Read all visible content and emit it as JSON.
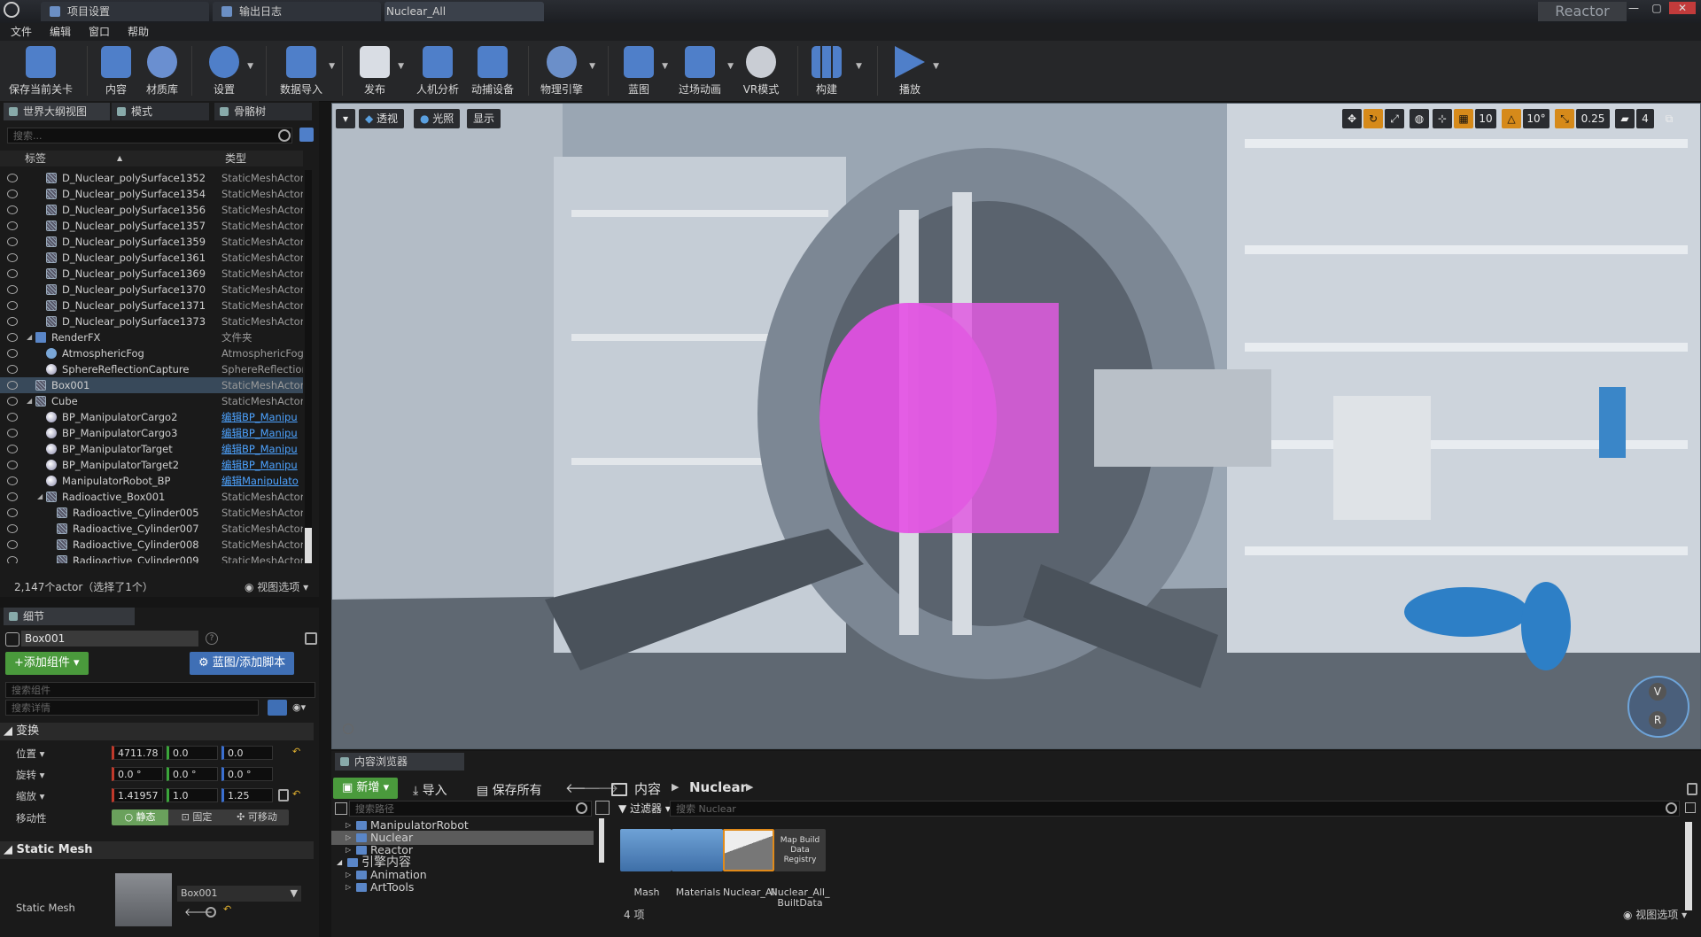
{
  "titlebar": {
    "tabs": [
      {
        "label": "项目设置"
      },
      {
        "label": "输出日志"
      },
      {
        "label": "Nuclear_All"
      }
    ],
    "project_name": "Reactor"
  },
  "menubar": {
    "items": [
      "文件",
      "编辑",
      "窗口",
      "帮助"
    ]
  },
  "toolbar": {
    "buttons": [
      {
        "label": "保存当前关卡",
        "icon": "save-icon"
      },
      {
        "label": "内容",
        "icon": "content-grid-icon"
      },
      {
        "label": "材质库",
        "icon": "material-spheres-icon"
      },
      {
        "label": "设置",
        "icon": "gear-icon"
      },
      {
        "label": "数据导入",
        "icon": "data-import-icon"
      },
      {
        "label": "发布",
        "icon": "publish-icon"
      },
      {
        "label": "人机分析",
        "icon": "ergonomics-icon"
      },
      {
        "label": "动捕设备",
        "icon": "motion-capture-icon"
      },
      {
        "label": "物理引擎",
        "icon": "physics-gear-icon"
      },
      {
        "label": "蓝图",
        "icon": "blueprint-icon"
      },
      {
        "label": "过场动画",
        "icon": "cinematics-icon"
      },
      {
        "label": "VR模式",
        "icon": "vr-headset-icon"
      },
      {
        "label": "构建",
        "icon": "build-icon"
      },
      {
        "label": "播放",
        "icon": "play-icon"
      }
    ]
  },
  "outliner": {
    "tabs": [
      {
        "label": "世界大纲视图"
      },
      {
        "label": "模式"
      },
      {
        "label": "骨骼树"
      }
    ],
    "search_placeholder": "搜索...",
    "col_label": "标签",
    "col_type": "类型",
    "rows": [
      {
        "name": "D_Nuclear_polySurface1352",
        "type": "StaticMeshActor",
        "indent": 2,
        "icon": "mesh"
      },
      {
        "name": "D_Nuclear_polySurface1354",
        "type": "StaticMeshActor",
        "indent": 2,
        "icon": "mesh"
      },
      {
        "name": "D_Nuclear_polySurface1356",
        "type": "StaticMeshActor",
        "indent": 2,
        "icon": "mesh"
      },
      {
        "name": "D_Nuclear_polySurface1357",
        "type": "StaticMeshActor",
        "indent": 2,
        "icon": "mesh"
      },
      {
        "name": "D_Nuclear_polySurface1359",
        "type": "StaticMeshActor",
        "indent": 2,
        "icon": "mesh"
      },
      {
        "name": "D_Nuclear_polySurface1361",
        "type": "StaticMeshActor",
        "indent": 2,
        "icon": "mesh"
      },
      {
        "name": "D_Nuclear_polySurface1369",
        "type": "StaticMeshActor",
        "indent": 2,
        "icon": "mesh"
      },
      {
        "name": "D_Nuclear_polySurface1370",
        "type": "StaticMeshActor",
        "indent": 2,
        "icon": "mesh"
      },
      {
        "name": "D_Nuclear_polySurface1371",
        "type": "StaticMeshActor",
        "indent": 2,
        "icon": "mesh"
      },
      {
        "name": "D_Nuclear_polySurface1373",
        "type": "StaticMeshActor",
        "indent": 2,
        "icon": "mesh"
      },
      {
        "name": "RenderFX",
        "type": "文件夹",
        "indent": 1,
        "icon": "folder",
        "expand": true
      },
      {
        "name": "AtmosphericFog",
        "type": "AtmosphericFog",
        "indent": 2,
        "icon": "fog"
      },
      {
        "name": "SphereReflectionCapture",
        "type": "SphereReflection",
        "indent": 2,
        "icon": "bp"
      },
      {
        "name": "Box001",
        "type": "StaticMeshActor",
        "indent": 1,
        "icon": "mesh",
        "selected": true
      },
      {
        "name": "Cube",
        "type": "StaticMeshActor",
        "indent": 1,
        "icon": "mesh",
        "expand": true
      },
      {
        "name": "BP_ManipulatorCargo2",
        "type": "编辑BP_Manipu",
        "indent": 2,
        "icon": "bp",
        "link": true
      },
      {
        "name": "BP_ManipulatorCargo3",
        "type": "编辑BP_Manipu",
        "indent": 2,
        "icon": "bp",
        "link": true
      },
      {
        "name": "BP_ManipulatorTarget",
        "type": "编辑BP_Manipu",
        "indent": 2,
        "icon": "bp",
        "link": true
      },
      {
        "name": "BP_ManipulatorTarget2",
        "type": "编辑BP_Manipu",
        "indent": 2,
        "icon": "bp",
        "link": true
      },
      {
        "name": "ManipulatorRobot_BP",
        "type": "编辑Manipulato",
        "indent": 2,
        "icon": "bp",
        "link": true
      },
      {
        "name": "Radioactive_Box001",
        "type": "StaticMeshActor",
        "indent": 2,
        "icon": "mesh",
        "expand": true
      },
      {
        "name": "Radioactive_Cylinder005",
        "type": "StaticMeshActor",
        "indent": 3,
        "icon": "mesh"
      },
      {
        "name": "Radioactive_Cylinder007",
        "type": "StaticMeshActor",
        "indent": 3,
        "icon": "mesh"
      },
      {
        "name": "Radioactive_Cylinder008",
        "type": "StaticMeshActor",
        "indent": 3,
        "icon": "mesh"
      },
      {
        "name": "Radioactive_Cylinder009",
        "type": "StaticMeshActor",
        "indent": 3,
        "icon": "mesh"
      }
    ],
    "status": "2,147个actor（选择了1个）",
    "view_options": "视图选项"
  },
  "details": {
    "tab": "细节",
    "object_name": "Box001",
    "add_component": "添加组件",
    "blueprint_script": "蓝图/添加脚本",
    "search_components": "搜索组件",
    "search_details": "搜索详情",
    "section_transform": "变换",
    "location_label": "位置",
    "rotation_label": "旋转",
    "scale_label": "缩放",
    "mobility_label": "移动性",
    "location": [
      "4711.78",
      "0.0",
      "0.0"
    ],
    "rotation": [
      "0.0 °",
      "0.0 °",
      "0.0 °"
    ],
    "scale": [
      "1.41957",
      "1.0",
      "1.25"
    ],
    "mobility": [
      "静态",
      "固定",
      "可移动"
    ],
    "section_static_mesh": "Static Mesh",
    "static_mesh_label": "Static Mesh",
    "static_mesh_value": "Box001"
  },
  "viewport": {
    "perspective": "透视",
    "lit": "光照",
    "show": "显示",
    "grid_snap": "10",
    "rot_snap": "10°",
    "scale_snap": "0.25",
    "camera_speed": "4",
    "gizmo_v": "V",
    "gizmo_r": "R"
  },
  "content_browser": {
    "tab": "内容浏览器",
    "new_button": "新增",
    "import_button": "导入",
    "save_all_button": "保存所有",
    "crumb_root": "内容",
    "crumb_current": "Nuclear",
    "search_paths_placeholder": "搜索路径",
    "filters": "过滤器",
    "search_assets_placeholder": "搜索 Nuclear",
    "tree": [
      {
        "label": "ManipulatorRobot",
        "indent": 1
      },
      {
        "label": "Nuclear",
        "indent": 1,
        "selected": true
      },
      {
        "label": "Reactor",
        "indent": 1
      },
      {
        "label": "引擎内容",
        "indent": 0,
        "big": true
      },
      {
        "label": "Animation",
        "indent": 1
      },
      {
        "label": "ArtTools",
        "indent": 1
      }
    ],
    "assets": [
      {
        "label": "Mash",
        "kind": "folder"
      },
      {
        "label": "Materials",
        "kind": "folder"
      },
      {
        "label": "Nuclear_All",
        "kind": "level"
      },
      {
        "label": "Nuclear_All_BuiltData",
        "kind": "data",
        "thumb_text": "Map Build Data Registry"
      }
    ],
    "count": "4 项",
    "view_options": "视图选项"
  }
}
